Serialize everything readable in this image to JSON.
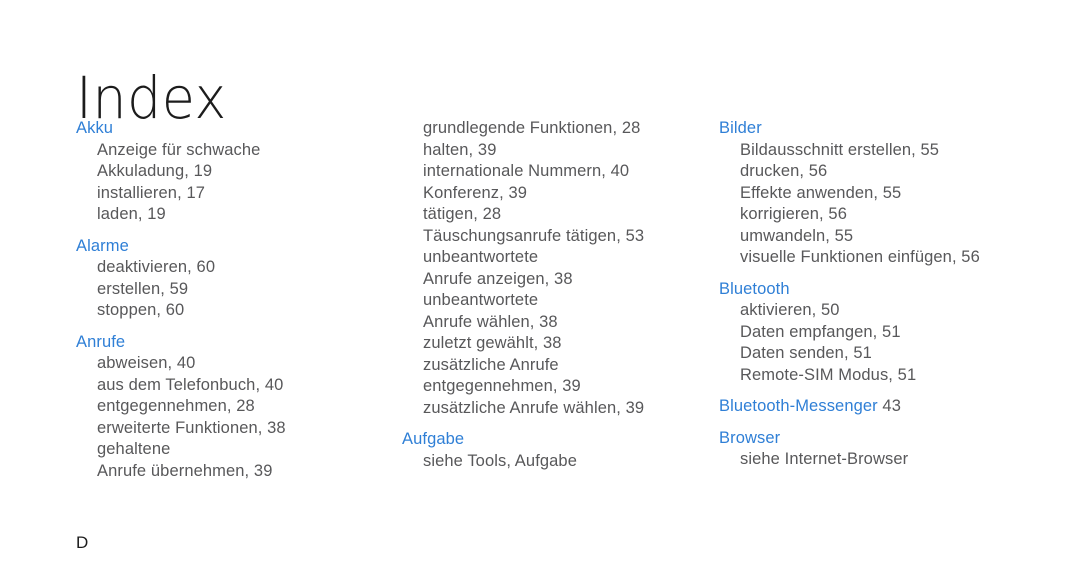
{
  "page": {
    "title": "Index",
    "background_color": "#ffffff",
    "heading_color": "#2f7fd6",
    "entry_color": "#58585a",
    "section_letter": "D"
  },
  "columns": [
    {
      "id": "column-1",
      "groups": [
        {
          "heading": "Akku",
          "heading_page": "",
          "entries": [
            "Anzeige für schwache",
            "Akkuladung, 19",
            "installieren, 17",
            "laden, 19"
          ]
        },
        {
          "heading": "Alarme",
          "heading_page": "",
          "entries": [
            "deaktivieren, 60",
            "erstellen, 59",
            "stoppen, 60"
          ]
        },
        {
          "heading": "Anrufe",
          "heading_page": "",
          "entries": [
            "abweisen, 40",
            "aus dem Telefonbuch, 40",
            "entgegennehmen, 28",
            "erweiterte Funktionen, 38",
            "gehaltene",
            "Anrufe übernehmen, 39"
          ]
        }
      ]
    },
    {
      "id": "column-2",
      "groups": [
        {
          "heading": "",
          "heading_page": "",
          "entries": [
            "grundlegende Funktionen, 28",
            "halten, 39",
            "internationale Nummern, 40",
            "Konferenz, 39",
            "tätigen, 28",
            "Täuschungsanrufe tätigen, 53",
            "unbeantwortete",
            "Anrufe anzeigen, 38",
            "unbeantwortete",
            "Anrufe wählen, 38",
            "zuletzt gewählt, 38",
            "zusätzliche Anrufe",
            "entgegennehmen, 39",
            "zusätzliche Anrufe wählen, 39"
          ]
        },
        {
          "heading": "Aufgabe",
          "heading_page": "",
          "entries": [
            "siehe Tools, Aufgabe"
          ]
        }
      ]
    },
    {
      "id": "column-3",
      "groups": [
        {
          "heading": "Bilder",
          "heading_page": "",
          "entries": [
            "Bildausschnitt erstellen, 55",
            "drucken, 56",
            "Effekte anwenden, 55",
            "korrigieren, 56",
            "umwandeln, 55",
            "visuelle Funktionen einfügen, 56"
          ]
        },
        {
          "heading": "Bluetooth",
          "heading_page": "",
          "entries": [
            "aktivieren, 50",
            "Daten empfangen, 51",
            "Daten senden, 51",
            "Remote-SIM Modus, 51"
          ]
        },
        {
          "heading": "Bluetooth-Messenger",
          "heading_page": "43",
          "entries": []
        },
        {
          "heading": "Browser",
          "heading_page": "",
          "entries": [
            "siehe Internet-Browser"
          ]
        }
      ]
    }
  ]
}
